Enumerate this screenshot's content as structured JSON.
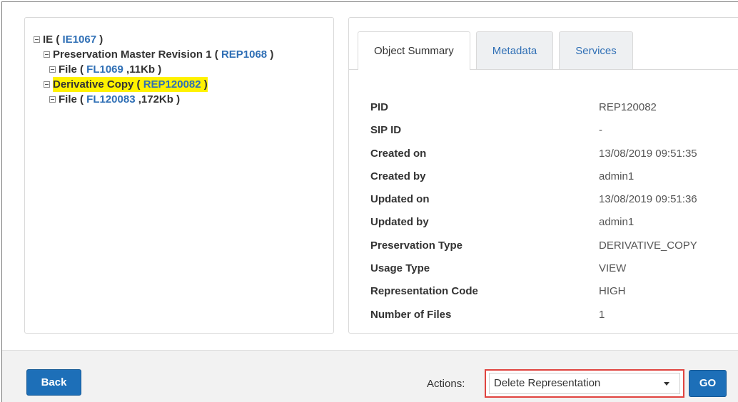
{
  "tree": {
    "ie": {
      "prefix": "IE ( ",
      "id": "IE1067",
      "suffix": " )"
    },
    "rep1": {
      "prefix": "Preservation Master Revision 1 ( ",
      "id": "REP1068",
      "suffix": " )"
    },
    "file1": {
      "prefix": "File ( ",
      "id": "FL1069",
      "suffix": " ,11Kb )"
    },
    "rep2": {
      "prefix": "Derivative Copy ( ",
      "id": "REP120082",
      "suffix": " )"
    },
    "file2": {
      "prefix": "File ( ",
      "id": "FL120083",
      "suffix": " ,172Kb )"
    }
  },
  "tabs": [
    "Object Summary",
    "Metadata",
    "Services"
  ],
  "properties": [
    {
      "key": "PID",
      "value": "REP120082"
    },
    {
      "key": "SIP ID",
      "value": "-"
    },
    {
      "key": "Created on",
      "value": "13/08/2019 09:51:35"
    },
    {
      "key": "Created by",
      "value": "admin1"
    },
    {
      "key": "Updated on",
      "value": "13/08/2019 09:51:36"
    },
    {
      "key": "Updated by",
      "value": "admin1"
    },
    {
      "key": "Preservation Type",
      "value": "DERIVATIVE_COPY"
    },
    {
      "key": "Usage Type",
      "value": "VIEW"
    },
    {
      "key": "Representation Code",
      "value": "HIGH"
    },
    {
      "key": "Number of Files",
      "value": "1"
    }
  ],
  "footer": {
    "back_label": "Back",
    "actions_label": "Actions:",
    "selected_action": "Delete Representation",
    "go_label": "GO"
  },
  "colors": {
    "link": "#2f6fb5",
    "highlight": "#fff200",
    "button": "#1d6fb8",
    "select_outline": "#e0433f"
  },
  "icons": [
    "tree-collapse-icon",
    "dropdown-caret-icon"
  ]
}
